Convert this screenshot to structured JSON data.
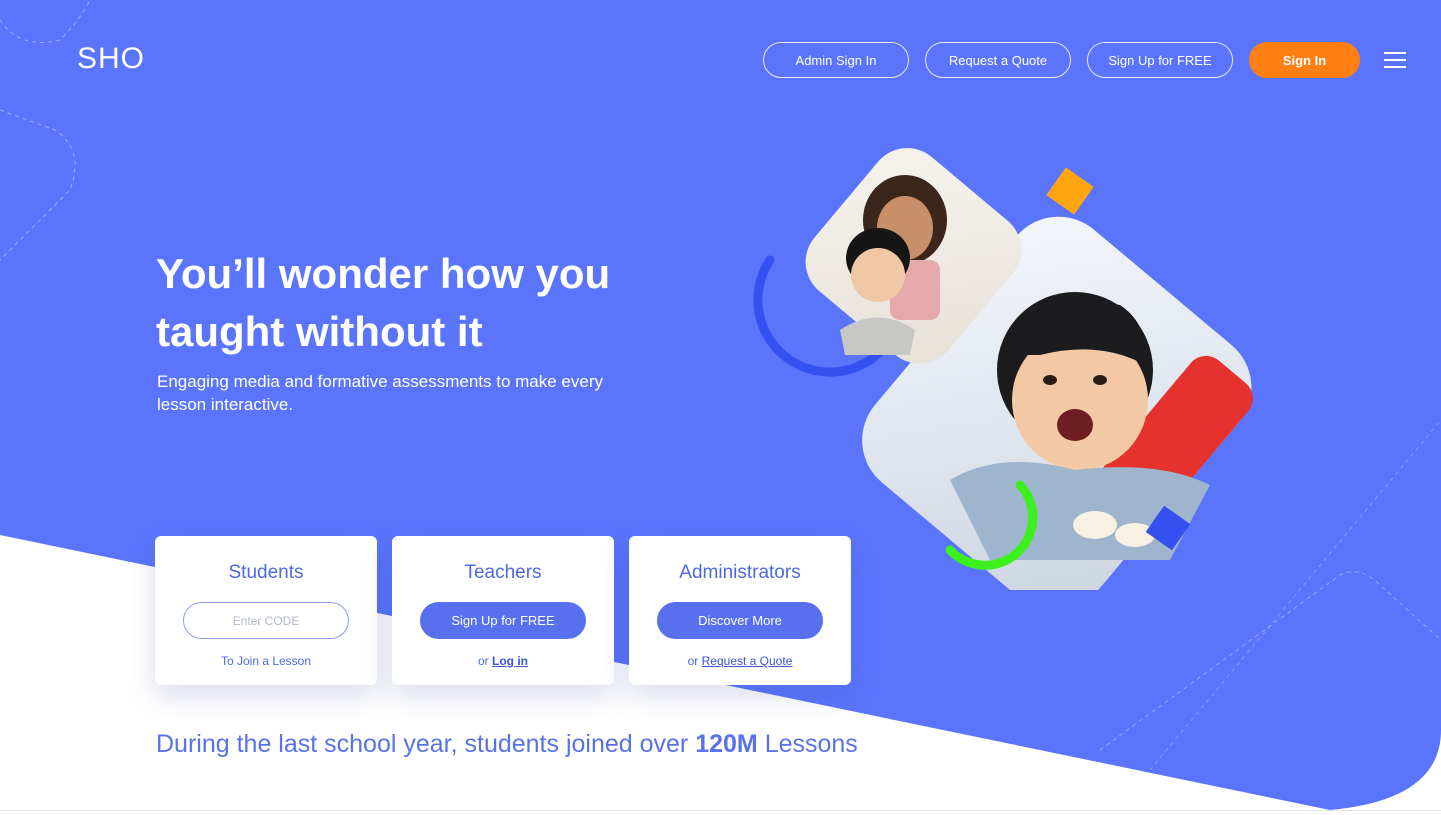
{
  "brand": {
    "logo_text": "SHO"
  },
  "nav": {
    "admin_sign_in": "Admin Sign In",
    "request_quote": "Request a Quote",
    "sign_up_free": "Sign Up for FREE",
    "sign_in": "Sign In"
  },
  "hero": {
    "headline": "You’ll wonder how you taught without it",
    "subline": "Engaging media and formative assessments to make every lesson interactive."
  },
  "cards": {
    "students": {
      "title": "Students",
      "input_placeholder": "Enter CODE",
      "footer": "To Join a Lesson"
    },
    "teachers": {
      "title": "Teachers",
      "button": "Sign Up for FREE",
      "footer_prefix": "or ",
      "footer_link": "Log in"
    },
    "administrators": {
      "title": "Administrators",
      "button": "Discover More",
      "footer_prefix": "or ",
      "footer_link": "Request a Quote"
    }
  },
  "stats": {
    "prefix": "During the last school year, students joined over ",
    "highlight": "120M",
    "suffix": " Lessons"
  },
  "colors": {
    "hero_blue": "#5a75fc",
    "accent_orange": "#ff7f12",
    "card_blue": "#5970ee",
    "deco_yellow": "#ffa50f",
    "deco_green": "#3cf01e"
  },
  "icons": {
    "menu": "hamburger-menu-icon"
  }
}
